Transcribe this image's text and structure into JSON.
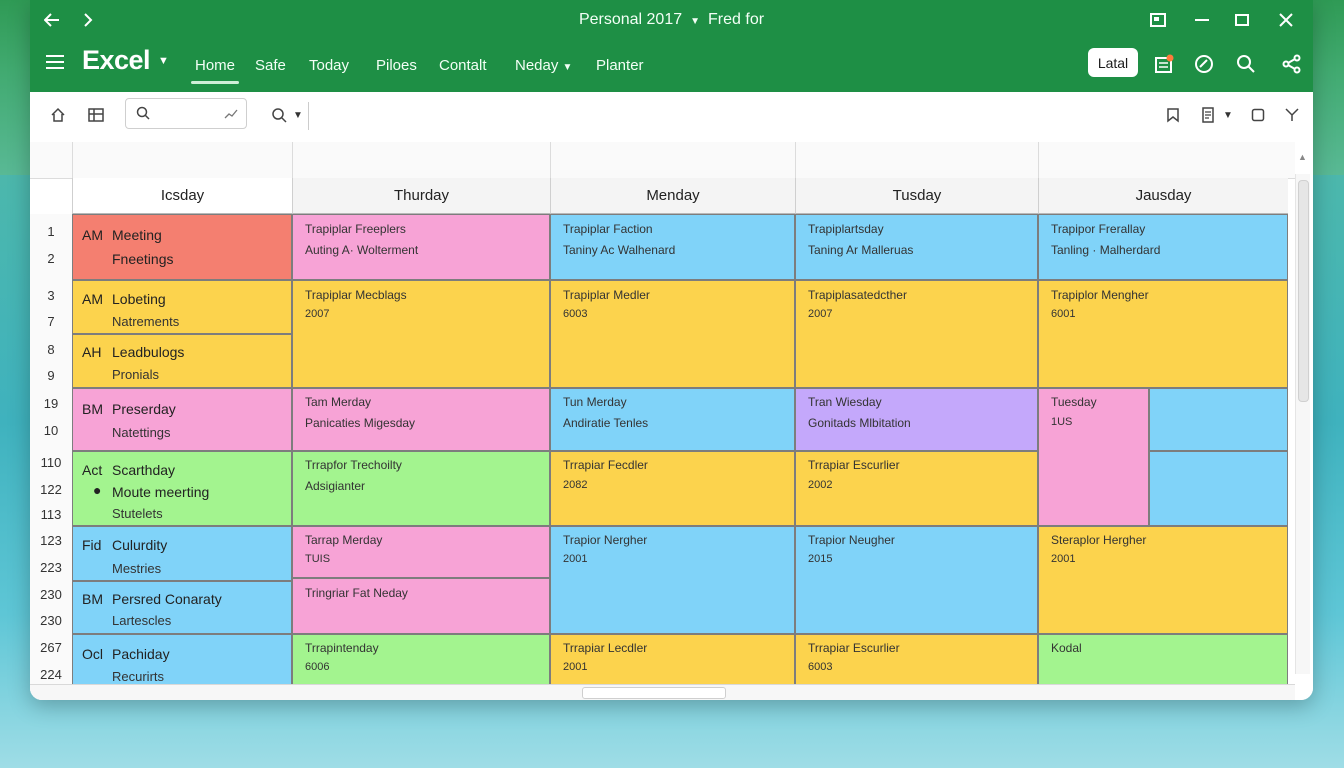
{
  "colors": {
    "title_bar": "#1e8f45",
    "red": "#f47f70",
    "pink": "#f7a3d6",
    "blue": "#80d3f9",
    "yellow": "#fcd34d",
    "green": "#a3f48f",
    "purple": "#c4a8fb"
  },
  "window": {
    "title": "Personal 2017",
    "title_right": "Fred for",
    "back_icon": "arrow-left-icon",
    "forward_icon": "chevron-right-icon"
  },
  "ribbon": {
    "app_name": "Excel",
    "tabs": [
      "Home",
      "Safe",
      "Today",
      "Piloes",
      "Contalt",
      "Neday",
      "Planter"
    ],
    "active_tab": "Home",
    "share_button": "Latal"
  },
  "grid": {
    "corner_header": "Icsday",
    "columns": [
      "Thurday",
      "Menday",
      "Tusday",
      "Jausday"
    ],
    "row_numbers": [
      "1",
      "2",
      "3",
      "7",
      "8",
      "9",
      "19",
      "10",
      "110",
      "122",
      "113",
      "123",
      "223",
      "230",
      "230",
      "267",
      "224"
    ],
    "left_events": [
      {
        "prefix": "AM",
        "title": "Meeting",
        "sub": "Fneetings"
      },
      {
        "prefix": "AM",
        "title": "Lobeting",
        "sub": "Natrements"
      },
      {
        "prefix": "AH",
        "title": "Leadbulogs",
        "sub": "Pronials"
      },
      {
        "prefix": "BM",
        "title": "Preserday",
        "sub": "Natettings"
      },
      {
        "prefix": "Act",
        "title": "Scarthday",
        "bullet": "Moute meerting",
        "sub": "Stutelets"
      },
      {
        "prefix": "Fid",
        "title": "Culurdity",
        "sub": "Mestries"
      },
      {
        "prefix": "BM",
        "title": "Persred Conaraty",
        "sub": "Lartescles"
      },
      {
        "prefix": "Ocl",
        "title": "Pachiday",
        "sub": "Recurirts"
      }
    ],
    "cells": [
      {
        "l1": "Trapiplar Freeplers",
        "l2": "Auting A· Wolterment"
      },
      {
        "l1": "Trapiplar Faction",
        "l2": "Taniny Ac Walhenard"
      },
      {
        "l1": "Trapiplartsday",
        "l2": "Taning Ar Malleruas"
      },
      {
        "l1": "Trapipor Frerallay",
        "l2": "Tanling · Malherdard"
      },
      {
        "l1": "Trapiplar Mecblags",
        "l2": "2007"
      },
      {
        "l1": "Trapiplar Medler",
        "l2": "6003"
      },
      {
        "l1": "Trapiplasatedcther",
        "l2": "2007"
      },
      {
        "l1": "Trapiplor Mengher",
        "l2": "6001"
      },
      {
        "l1": "Tam Merday",
        "l2": "Panicaties Migesday"
      },
      {
        "l1": "Tun Merday",
        "l2": "Andiratie Tenles"
      },
      {
        "l1": "Tran Wiesday",
        "l2": "Gonitads Mlbitation"
      },
      {
        "l1": "Tuesday",
        "l2": "1US"
      },
      {
        "l1": "Trrapfor Trechoilty",
        "l2": "Adsigianter"
      },
      {
        "l1": "Trrapiar Fecdler",
        "l2": "2082"
      },
      {
        "l1": "Trrapiar Escurlier",
        "l2": "2002"
      },
      {
        "l1": "Tarrap Merday",
        "l2": "TUIS"
      },
      {
        "l1": "Trapior Nergher",
        "l2": "2001"
      },
      {
        "l1": "Trapior Neugher",
        "l2": "2015"
      },
      {
        "l1": "Steraplor Hergher",
        "l2": "2001"
      },
      {
        "l1": "Tringriar Fat Neday",
        "l2": ""
      },
      {
        "l1": "Trrapintenday",
        "l2": "6006"
      },
      {
        "l1": "Trrapiar Lecdler",
        "l2": "2001"
      },
      {
        "l1": "Trrapiar Escurlier",
        "l2": "6003"
      },
      {
        "l1": "Kodal",
        "l2": ""
      }
    ]
  }
}
